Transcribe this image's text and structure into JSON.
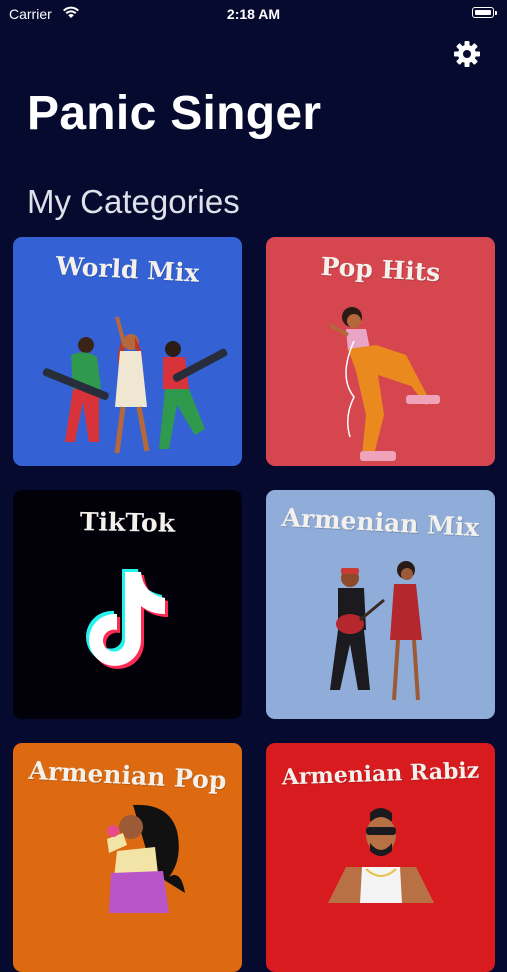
{
  "status_bar": {
    "carrier": "Carrier",
    "time": "2:18 AM",
    "wifi_icon": "wifi-icon",
    "battery_icon": "battery-icon"
  },
  "header": {
    "title": "Panic Singer",
    "settings_icon": "gear-icon"
  },
  "section": {
    "heading": "My Categories"
  },
  "categories": [
    {
      "label": "World Mix",
      "color": "#3462d4"
    },
    {
      "label": "Pop Hits",
      "color": "#d5464f"
    },
    {
      "label": "TikTok",
      "color": "#02010a"
    },
    {
      "label": "Armenian Mix",
      "color": "#8fadd8"
    },
    {
      "label": "Armenian Pop",
      "color": "#dd6a10"
    },
    {
      "label": "Armenian Rabiz",
      "color": "#d81b1f"
    }
  ],
  "colors": {
    "background": "#050a2e",
    "text": "#ffffff"
  }
}
